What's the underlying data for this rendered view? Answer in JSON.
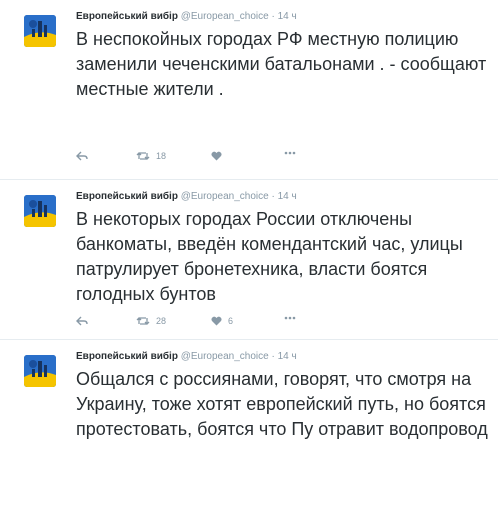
{
  "tweets": [
    {
      "author": "Европейський вибір",
      "handle": "@European_choice",
      "time": "14 ч",
      "text": "В неспокойных городах РФ местную полицию заменили чеченскими батальонами . - сообщают местные жители .",
      "retweets": "18",
      "likes": ""
    },
    {
      "author": "Европейський вибір",
      "handle": "@European_choice",
      "time": "14 ч",
      "text": "В некоторых городах России отключены банкоматы, введён комендантский час, улицы патрулирует бронетехника, власти боятся голодных бунтов",
      "retweets": "28",
      "likes": "6"
    },
    {
      "author": "Европейський вибір",
      "handle": "@European_choice",
      "time": "14 ч",
      "text": "Общался с россиянами, говорят, что смотря на Украину, тоже хотят европейский путь, но боятся протестовать, боятся что Пу отравит водопровод",
      "retweets": "",
      "likes": ""
    }
  ],
  "separator": "·",
  "icons": {
    "reply": "reply-icon",
    "retweet": "retweet-icon",
    "like": "heart-icon",
    "more": "more-icon"
  },
  "colors": {
    "text": "#292f33",
    "meta": "#8899a6",
    "avatar_blue": "#2a6fc9",
    "avatar_yellow": "#f5c400"
  }
}
